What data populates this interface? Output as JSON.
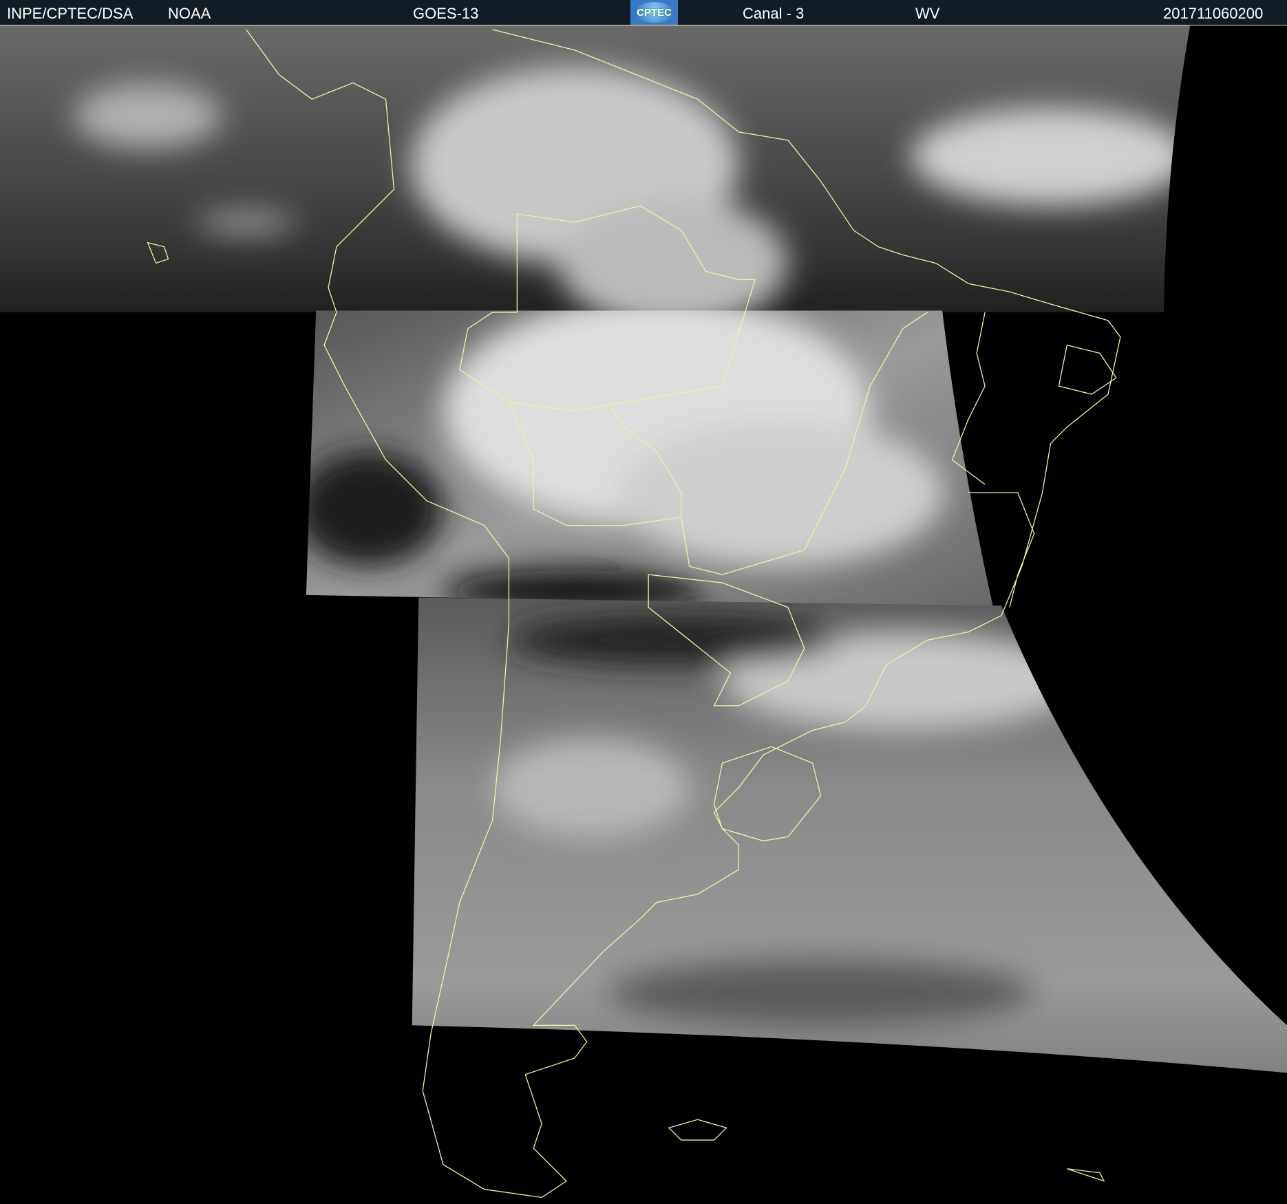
{
  "header": {
    "source": "INPE/CPTEC/DSA",
    "agency": "NOAA",
    "satellite": "GOES-13",
    "logo_text": "CPTEC",
    "channel": "Canal - 3",
    "band": "WV",
    "timestamp": "201711060200"
  },
  "colors": {
    "header_bg": "#111d26",
    "coastline": "#f0f0a8",
    "space": "#000000"
  }
}
